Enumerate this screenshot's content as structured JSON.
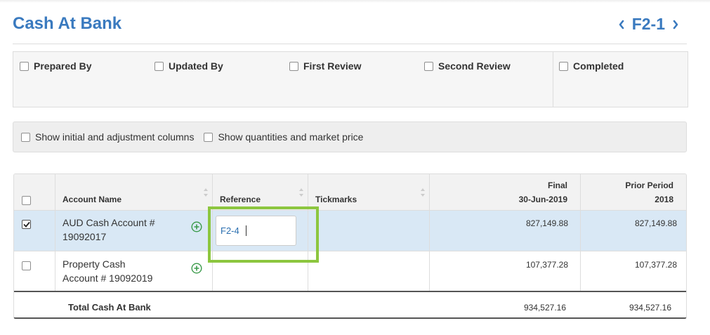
{
  "header": {
    "title": "Cash At Bank",
    "code": "F2-1"
  },
  "review": {
    "items": [
      {
        "label": "Prepared By",
        "checked": false
      },
      {
        "label": "Updated By",
        "checked": false
      },
      {
        "label": "First Review",
        "checked": false
      },
      {
        "label": "Second Review",
        "checked": false
      },
      {
        "label": "Completed",
        "checked": false
      }
    ]
  },
  "options": {
    "show_initial": {
      "label": "Show initial and adjustment columns",
      "checked": false
    },
    "show_quantities": {
      "label": "Show quantities and market price",
      "checked": false
    }
  },
  "table": {
    "columns": {
      "account_name": "Account Name",
      "reference": "Reference",
      "tickmarks": "Tickmarks",
      "final_line1": "Final",
      "final_line2": "30-Jun-2019",
      "prior_line1": "Prior Period",
      "prior_line2": "2018"
    },
    "rows": [
      {
        "selected": true,
        "account_line1": "AUD Cash Account #",
        "account_line2": "19092017",
        "reference": "F2-4",
        "final": "827,149.88",
        "prior": "827,149.88"
      },
      {
        "selected": false,
        "account_line1": "Property Cash",
        "account_line2": "Account # 19092019",
        "reference": "",
        "final": "107,377.28",
        "prior": "107,377.28"
      }
    ],
    "total": {
      "label": "Total Cash At Bank",
      "final": "934,527.16",
      "prior": "934,527.16"
    }
  },
  "colors": {
    "accent": "#3a7abf",
    "selected_row": "#d9e8f5",
    "highlight": "#8cc63f",
    "plus_icon": "#3a9a4a"
  }
}
